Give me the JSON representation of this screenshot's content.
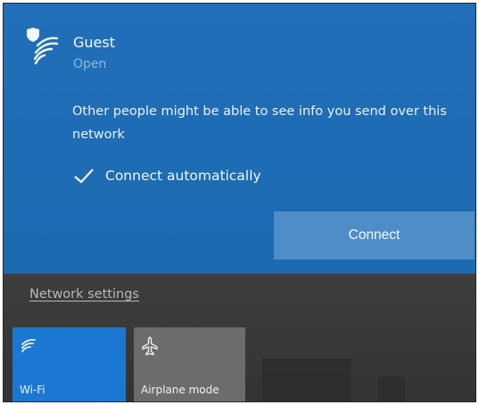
{
  "network": {
    "name": "Guest",
    "status": "Open",
    "warning": "Other people might be able to see info you send over this network",
    "connect_automatically_label": "Connect automatically",
    "connect_automatically_checked": true,
    "connect_button_label": "Connect"
  },
  "footer": {
    "network_settings_link": "Network settings"
  },
  "quick_actions": [
    {
      "label": "Wi-Fi",
      "icon": "wifi-icon",
      "active": true
    },
    {
      "label": "Airplane mode",
      "icon": "airplane-icon",
      "active": false
    }
  ],
  "colors": {
    "card_background": "#1e6db5",
    "connect_button": "#4e8dc8",
    "wifi_tile_active": "#1b78d2",
    "airplane_tile": "#6c6c6c",
    "panel_background": "#3d3d3d"
  }
}
